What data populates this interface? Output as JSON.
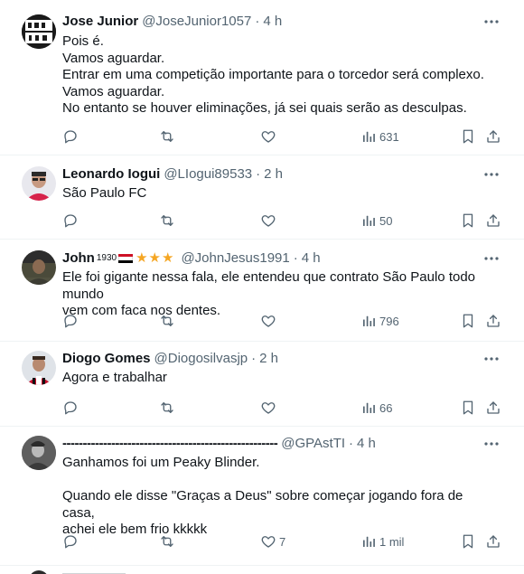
{
  "tweets": [
    {
      "name": "Jose Junior",
      "handle": "@JoseJunior1057",
      "time": "4 h",
      "lines": [
        "Pois é.",
        "Vamos aguardar.",
        "Entrar em uma competição importante para o torcedor será complexo.",
        "Vamos aguardar.",
        "No entanto se houver eliminações, já sei quais serão as desculpas."
      ],
      "replies": "",
      "retweets": "",
      "likes": "",
      "views": "631"
    },
    {
      "name": "Leonardo Iogui",
      "handle": "@LIogui89533",
      "time": "2 h",
      "lines": [
        "São Paulo FC"
      ],
      "replies": "",
      "retweets": "",
      "likes": "",
      "views": "50"
    },
    {
      "name": "John",
      "name_sup": "1930",
      "handle": "@JohnJesus1991",
      "time": "4 h",
      "lines": [
        "Ele foi gigante nessa fala, ele entendeu que contrato São Paulo todo mundo",
        "vem com faca nos dentes."
      ],
      "replies": "",
      "retweets": "",
      "likes": "",
      "views": "796"
    },
    {
      "name": "Diogo Gomes",
      "handle": "@Diogosilvasjp",
      "time": "2 h",
      "lines": [
        "Agora e trabalhar"
      ],
      "replies": "",
      "retweets": "",
      "likes": "",
      "views": "66"
    },
    {
      "name": "-----------------------------------------------------",
      "handle": "@GPAstTI",
      "time": "4 h",
      "lines": [
        "Ganhamos foi um Peaky Blinder.",
        "",
        "Quando ele disse \"Graças a Deus\" sobre começar jogando fora de casa,",
        "achei ele bem frio kkkkk"
      ],
      "replies": "",
      "retweets": "",
      "likes": "7",
      "views": "1 mil"
    }
  ],
  "separator": "·",
  "stars": "★★★",
  "icons": {
    "reply": "reply-icon",
    "retweet": "retweet-icon",
    "like": "heart-icon",
    "views": "views-icon",
    "bookmark": "bookmark-icon",
    "share": "share-icon",
    "more": "more-icon"
  },
  "colors": {
    "text": "#0f1419",
    "secondary": "#536471",
    "divider": "#eff3f4",
    "stars": "#f5a623"
  }
}
